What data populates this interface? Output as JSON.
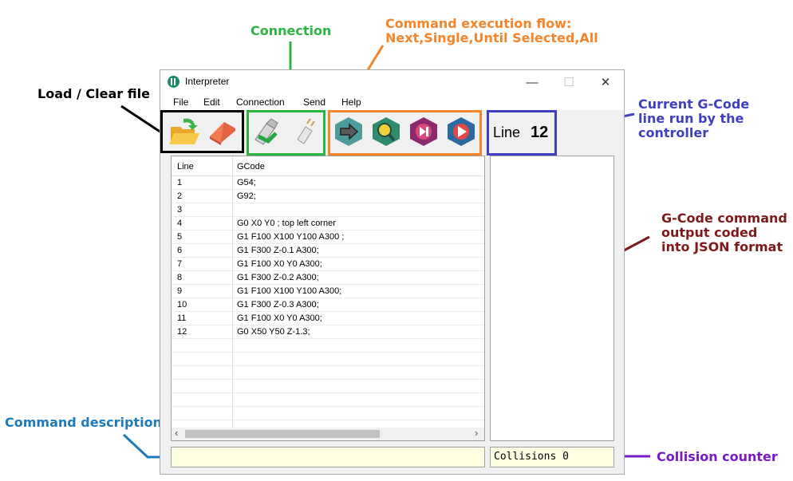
{
  "annotations": {
    "load_clear": "Load / Clear file",
    "connection": "Connection",
    "flow_line1": "Command execution flow:",
    "flow_line2": "Next,Single,Until Selected,All",
    "current_line1": "Current G-Code",
    "current_line2": "line run by the",
    "current_line3": "controller",
    "json_line1": "G-Code command",
    "json_line2": "output coded",
    "json_line3": "into JSON format",
    "cmd_desc": "Command description",
    "collision": "Collision counter"
  },
  "window": {
    "title": "Interpreter",
    "controls": {
      "minimize": "—",
      "maximize": "☐",
      "close": "✕"
    }
  },
  "menu": [
    "File",
    "Edit",
    "Connection",
    "Send",
    "Help"
  ],
  "toolbar": {
    "buttons": [
      {
        "name": "load-file-button",
        "icon": "folder-open-icon"
      },
      {
        "name": "clear-file-button",
        "icon": "eraser-icon"
      },
      {
        "name": "connect-button",
        "icon": "plug-connected-icon"
      },
      {
        "name": "disconnect-button",
        "icon": "plug-disconnected-icon"
      },
      {
        "name": "next-button",
        "icon": "arrow-right-icon"
      },
      {
        "name": "single-button",
        "icon": "magnifier-icon"
      },
      {
        "name": "until-selected-button",
        "icon": "skip-forward-icon"
      },
      {
        "name": "all-button",
        "icon": "play-icon"
      }
    ],
    "line_label": "Line",
    "line_value": "12"
  },
  "grid": {
    "headers": {
      "line": "Line",
      "gcode": "GCode"
    },
    "rows": [
      {
        "line": "1",
        "gcode": "G54;"
      },
      {
        "line": "2",
        "gcode": "G92;"
      },
      {
        "line": "3",
        "gcode": ""
      },
      {
        "line": "4",
        "gcode": "G0 X0 Y0  ; top left corner"
      },
      {
        "line": "5",
        "gcode": "G1 F100 X100 Y100 A300 ;"
      },
      {
        "line": "6",
        "gcode": "G1 F300 Z-0.1 A300;"
      },
      {
        "line": "7",
        "gcode": "G1 F100 X0 Y0 A300;"
      },
      {
        "line": "8",
        "gcode": "G1 F300 Z-0.2 A300;"
      },
      {
        "line": "9",
        "gcode": "G1 F100 X100 Y100 A300;"
      },
      {
        "line": "10",
        "gcode": "G1 F300 Z-0.3 A300;"
      },
      {
        "line": "11",
        "gcode": "G1 F100 X0 Y0 A300;"
      },
      {
        "line": "12",
        "gcode": "G0 X50 Y50 Z-1.3;"
      }
    ],
    "scroll_left": "‹",
    "scroll_right": "›"
  },
  "command_description": "",
  "collisions": "Collisions 0",
  "colors": {
    "black_box": "#000000",
    "green_box": "#2bb540",
    "orange_box": "#f5842a",
    "blue_box": "#3f3fbf",
    "maroon": "#7f1a1a",
    "teal": "#1f7ab8",
    "purple": "#7a19c8"
  }
}
